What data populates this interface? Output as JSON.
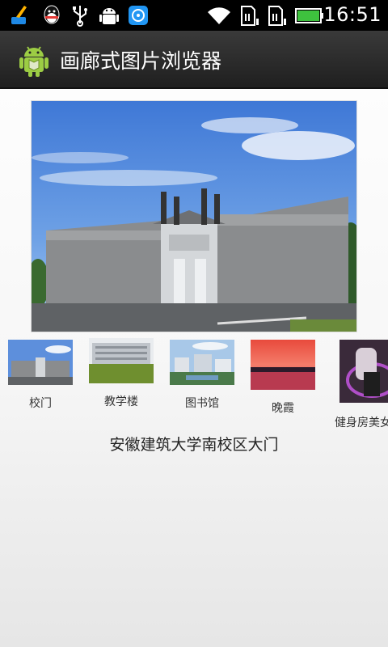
{
  "status_bar": {
    "time": "16:51",
    "icons": [
      "cleaner-broom-icon",
      "qq-penguin-icon",
      "usb-icon",
      "android-debug-icon",
      "message-app-icon",
      "wifi-icon",
      "sim1-signal-icon",
      "sim2-signal-icon",
      "battery-icon"
    ]
  },
  "action_bar": {
    "title": "画廊式图片浏览器",
    "icon": "android-app-icon"
  },
  "gallery": {
    "items": [
      {
        "label": "校门"
      },
      {
        "label": "教学楼"
      },
      {
        "label": "图书馆"
      },
      {
        "label": "晚霞"
      },
      {
        "label": "健身房美女"
      }
    ]
  },
  "selected_caption": "安徽建筑大学南校区大门",
  "colors": {
    "status_bar_bg": "#000000",
    "action_bar_bg": "#2a2a2a",
    "battery_green": "#3ec23e"
  }
}
